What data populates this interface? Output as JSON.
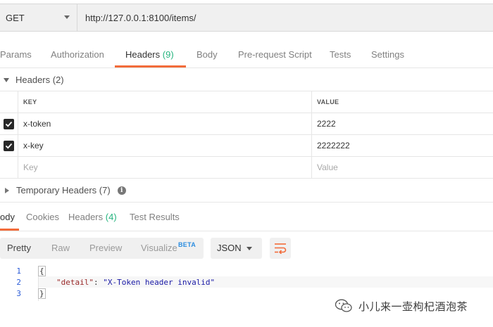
{
  "request": {
    "method": "GET",
    "url": "http://127.0.0.1:8100/items/"
  },
  "request_tabs": [
    {
      "label": "Params"
    },
    {
      "label": "Authorization"
    },
    {
      "label": "Headers",
      "count": "(9)",
      "active": true
    },
    {
      "label": "Body"
    },
    {
      "label": "Pre-request Script"
    },
    {
      "label": "Tests"
    },
    {
      "label": "Settings"
    }
  ],
  "headers_section": {
    "title": "Headers (2)",
    "columns": {
      "key": "KEY",
      "value": "VALUE"
    },
    "rows": [
      {
        "checked": true,
        "key": "x-token",
        "value": "2222"
      },
      {
        "checked": true,
        "key": "x-key",
        "value": "2222222"
      }
    ],
    "placeholder": {
      "key": "Key",
      "value": "Value"
    }
  },
  "temporary_headers": {
    "title": "Temporary Headers (7)"
  },
  "response_tabs": [
    {
      "label": "ody",
      "active": true
    },
    {
      "label": "Cookies"
    },
    {
      "label": "Headers",
      "count": "(4)"
    },
    {
      "label": "Test Results"
    }
  ],
  "view_options": {
    "pretty": "Pretty",
    "raw": "Raw",
    "preview": "Preview",
    "visualize": "Visualize",
    "beta": "BETA"
  },
  "format": {
    "selected": "JSON"
  },
  "code": {
    "lines": [
      "1",
      "2",
      "3"
    ],
    "open_brace": "{",
    "key": "\"detail\"",
    "colon": ": ",
    "value": "\"X-Token header invalid\"",
    "close_brace": "}"
  },
  "watermark": {
    "text": "小儿来一壶枸杞酒泡茶"
  },
  "colors": {
    "accent": "#f26b3a",
    "count_green": "#26b47f",
    "beta_blue": "#2b8de0"
  }
}
